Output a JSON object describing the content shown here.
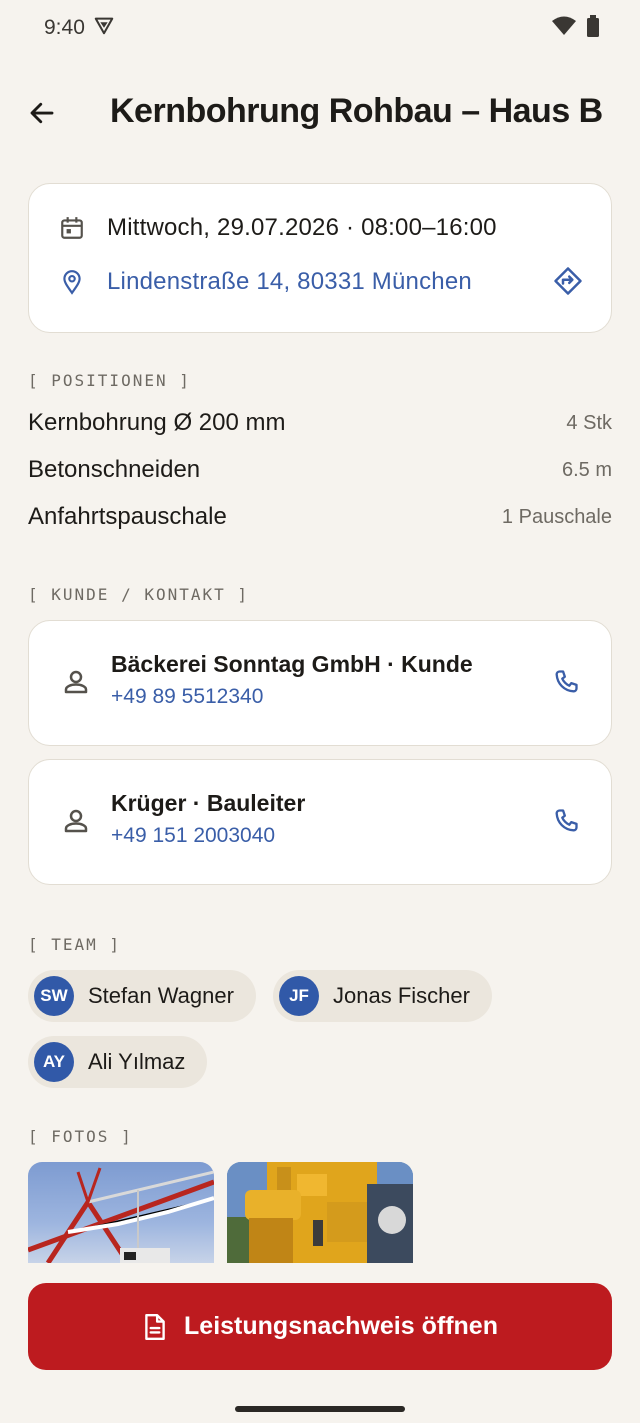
{
  "status_bar": {
    "time": "9:40"
  },
  "header": {
    "title": "Kernbohrung Rohbau – Haus B"
  },
  "info": {
    "date_time": "Mittwoch, 29.07.2026 · 08:00–16:00",
    "address": "Lindenstraße 14, 80331 München"
  },
  "positions": {
    "label": "[ POSITIONEN ]",
    "items": [
      {
        "name": "Kernbohrung Ø 200 mm",
        "qty": "4 Stk"
      },
      {
        "name": "Betonschneiden",
        "qty": "6.5 m"
      },
      {
        "name": "Anfahrtspauschale",
        "qty": "1 Pauschale"
      }
    ]
  },
  "contacts": {
    "label": "[ KUNDE / KONTAKT ]",
    "items": [
      {
        "name": "Bäckerei Sonntag GmbH · Kunde",
        "phone": "+49 89 5512340"
      },
      {
        "name": "Krüger · Bauleiter",
        "phone": "+49 151 2003040"
      }
    ]
  },
  "team": {
    "label": "[ TEAM ]",
    "members": [
      {
        "initials": "SW",
        "name": "Stefan Wagner"
      },
      {
        "initials": "JF",
        "name": "Jonas Fischer"
      },
      {
        "initials": "AY",
        "name": "Ali Yılmaz"
      }
    ]
  },
  "photos": {
    "label": "[ FOTOS ]"
  },
  "cta": {
    "label": "Leistungsnachweis öffnen"
  },
  "colors": {
    "background": "#f6f3ee",
    "link": "#3a5ea8",
    "avatar": "#3159a8",
    "cta": "#bd1b1f"
  }
}
